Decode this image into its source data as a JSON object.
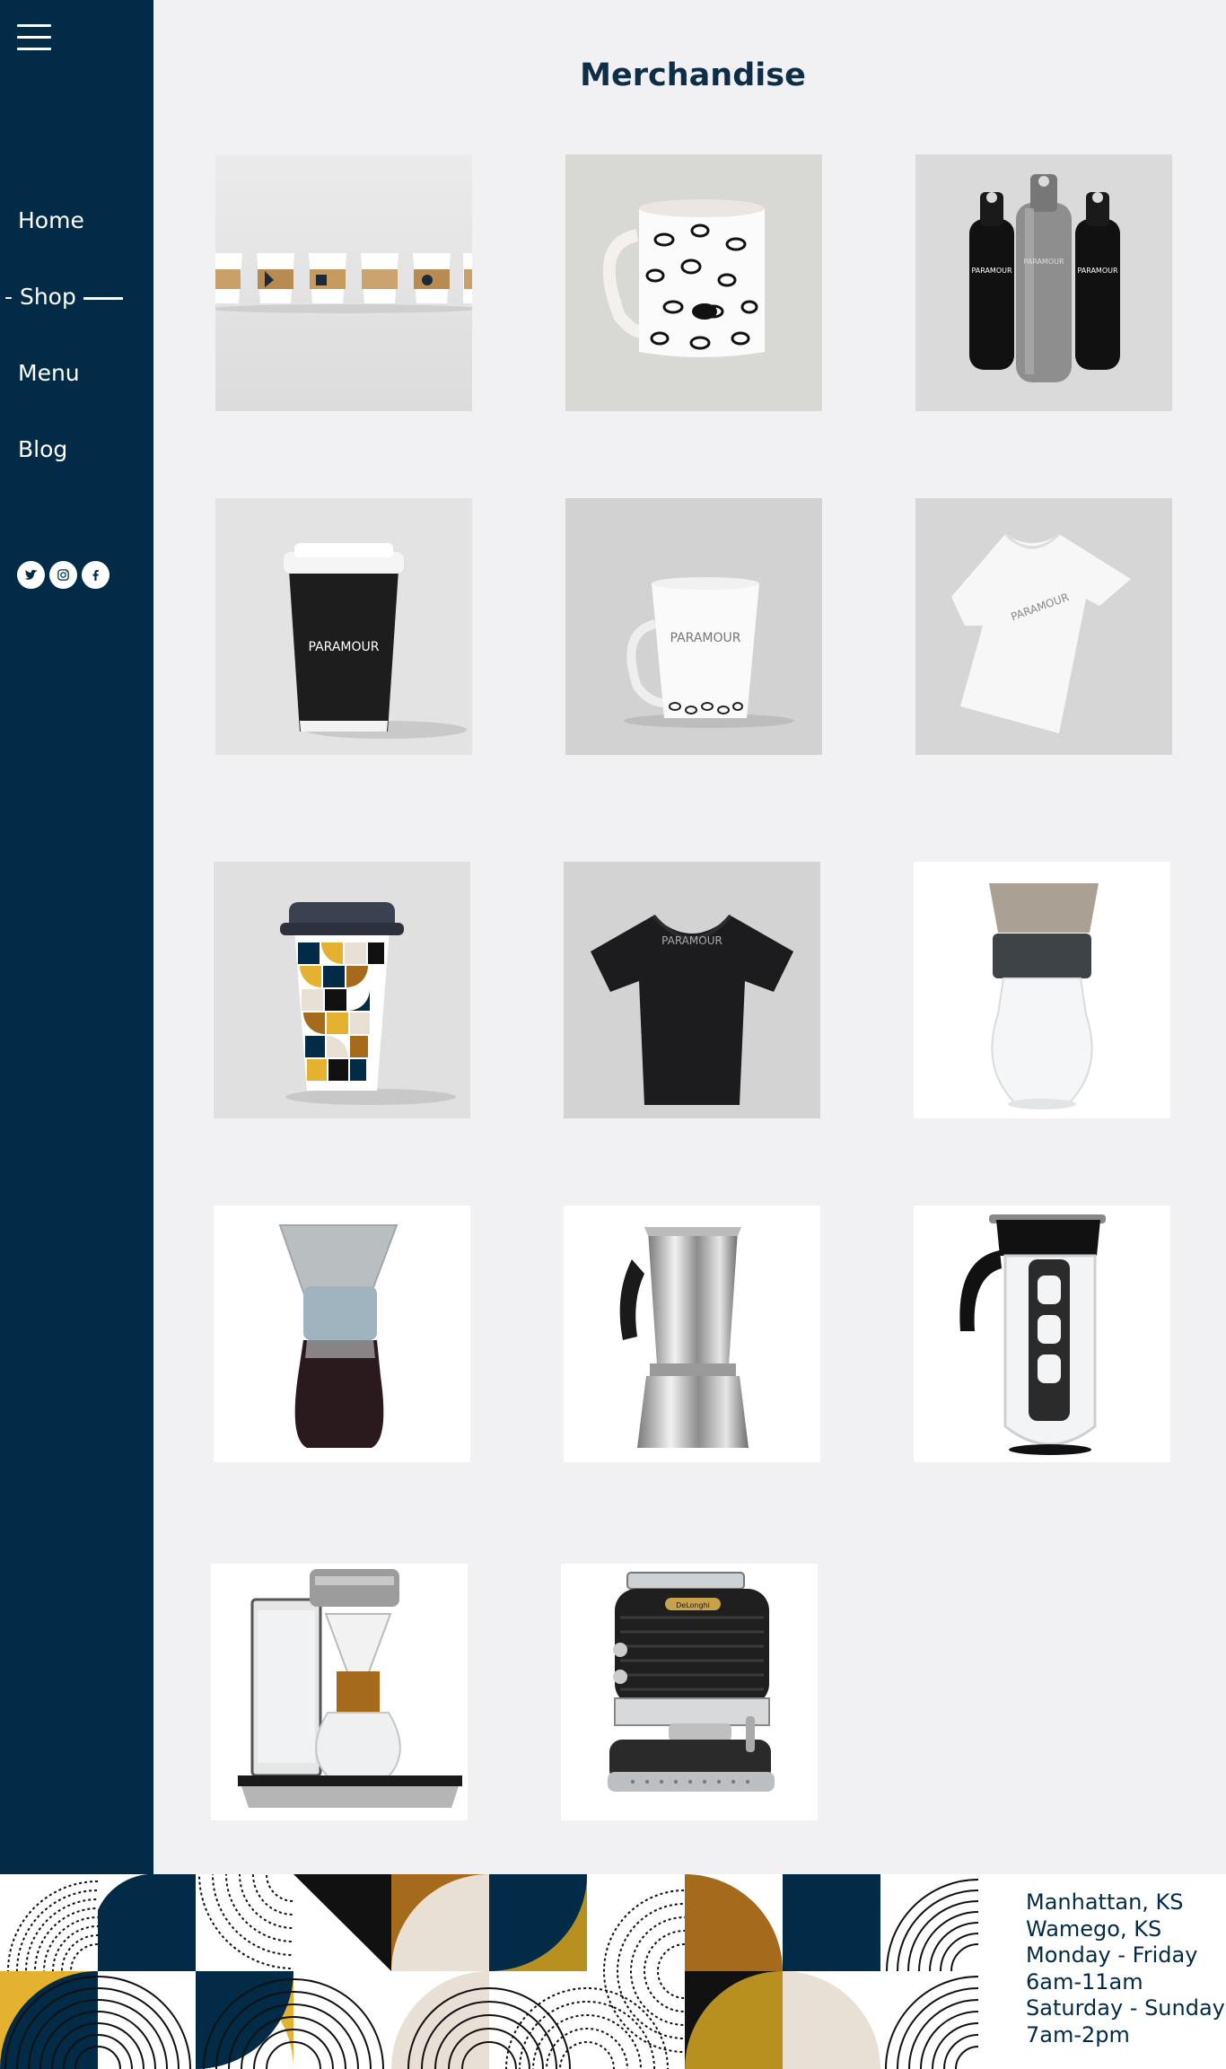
{
  "nav": {
    "items": [
      {
        "label": "Home"
      },
      {
        "label": "- Shop"
      },
      {
        "label": "Menu"
      },
      {
        "label": "Blog"
      }
    ],
    "socials": [
      "twitter-icon",
      "instagram-icon",
      "facebook-icon"
    ]
  },
  "page": {
    "title": "Merchandise"
  },
  "products": [
    {
      "name": "paper-cups-row",
      "brand": ""
    },
    {
      "name": "bean-pattern-mug",
      "brand": ""
    },
    {
      "name": "water-bottles",
      "brand": "PARAMOUR"
    },
    {
      "name": "black-paper-cup",
      "brand": "PARAMOUR"
    },
    {
      "name": "white-mug",
      "brand": "PARAMOUR"
    },
    {
      "name": "white-tshirt",
      "brand": "PARAMOUR"
    },
    {
      "name": "patterned-travel-cup",
      "brand": ""
    },
    {
      "name": "black-tshirt",
      "brand": "PARAMOUR"
    },
    {
      "name": "pour-over-carafe",
      "brand": ""
    },
    {
      "name": "glass-drip-carafe",
      "brand": ""
    },
    {
      "name": "stovetop-espresso-pot",
      "brand": ""
    },
    {
      "name": "cold-brew-pitcher",
      "brand": ""
    },
    {
      "name": "drip-coffee-maker",
      "brand": ""
    },
    {
      "name": "espresso-machine",
      "brand": "DeLonghi"
    }
  ],
  "footer": {
    "lines": [
      "Manhattan, KS",
      "Wamego, KS",
      "Monday - Friday",
      "6am-11am",
      "Saturday - Sunday",
      "7am-2pm"
    ]
  },
  "colors": {
    "navy": "#022b47",
    "gold": "#e4b230",
    "rust": "#a66a1c",
    "cream": "#e8e0d4",
    "black": "#111111"
  }
}
